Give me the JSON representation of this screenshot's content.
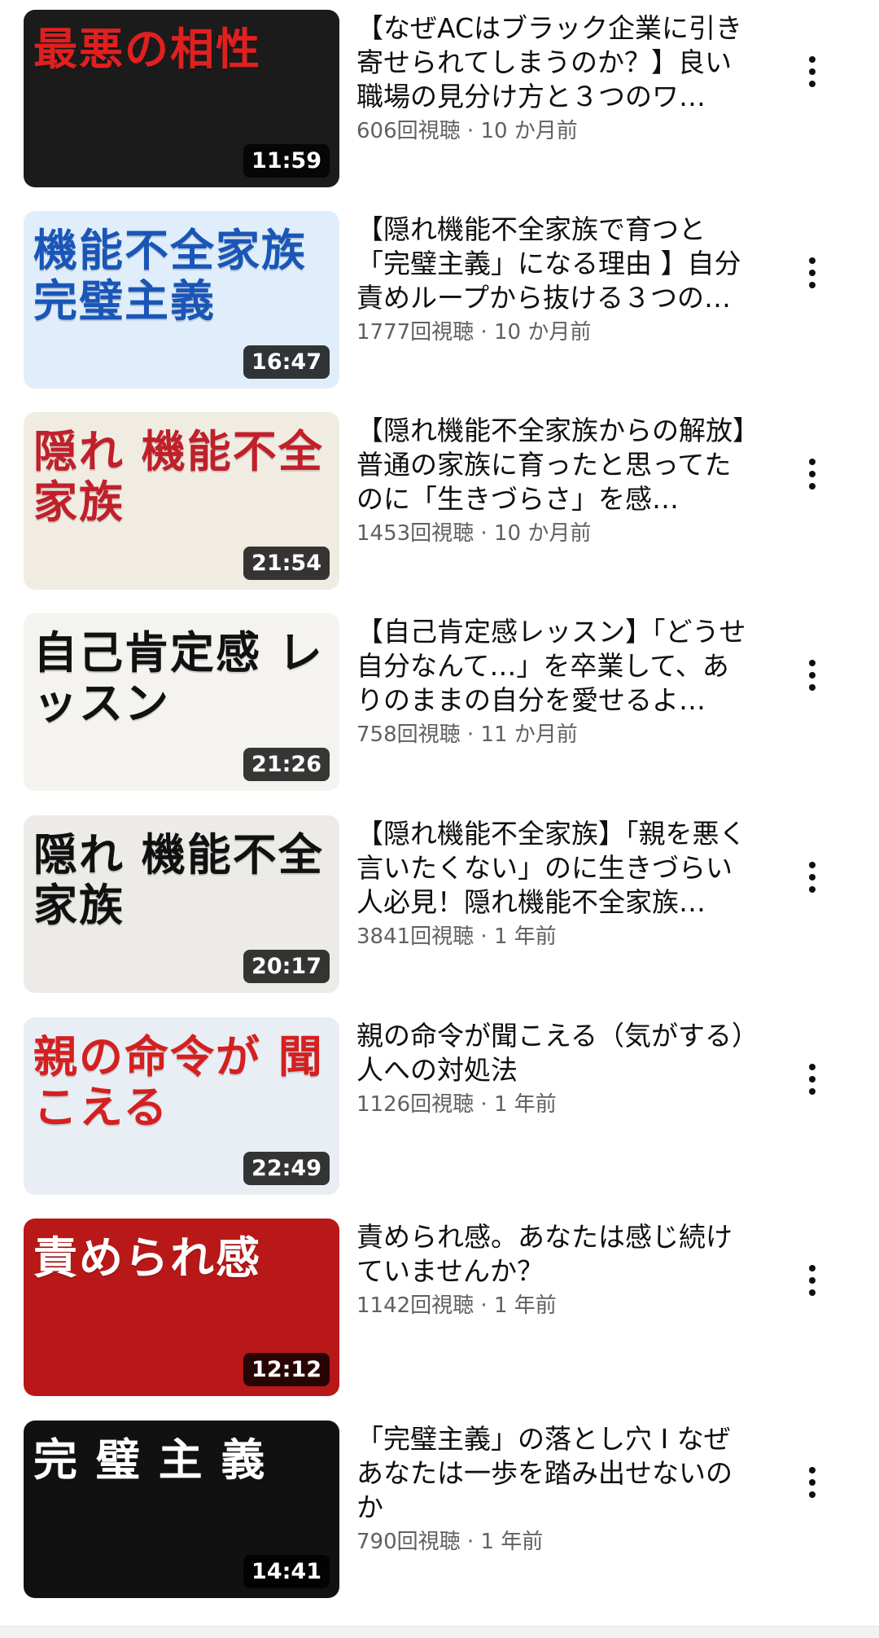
{
  "videos": [
    {
      "title": "【なぜACはブラック企業に引き寄せられてしまうのか？】良い職場の見分け方と３つのワ…",
      "views": "606回視聴",
      "age": "10 か月前",
      "duration": "11:59",
      "thumb_text": "最悪の相性",
      "thumb_bg": "#1b1b1b",
      "thumb_fg": "#e02020"
    },
    {
      "title": "【隠れ機能不全家族で育つと「完璧主義」になる理由 】自分責めループから抜ける３つの…",
      "views": "1777回視聴",
      "age": "10 か月前",
      "duration": "16:47",
      "thumb_text": "機能不全家族 完璧主義",
      "thumb_bg": "#dfeefa",
      "thumb_fg": "#1a56b8"
    },
    {
      "title": "【隠れ機能不全家族からの解放】普通の家族に育ったと思ってたのに「生きづらさ」を感…",
      "views": "1453回視聴",
      "age": "10 か月前",
      "duration": "21:54",
      "thumb_text": "隠れ 機能不全家族",
      "thumb_bg": "#f1ece2",
      "thumb_fg": "#c0202a"
    },
    {
      "title": "【自己肯定感レッスン】「どうせ自分なんて…」を卒業して、ありのままの自分を愛せるよ…",
      "views": "758回視聴",
      "age": "11 か月前",
      "duration": "21:26",
      "thumb_text": "自己肯定感 レッスン",
      "thumb_bg": "#f4f3ef",
      "thumb_fg": "#111111"
    },
    {
      "title": "【隠れ機能不全家族】「親を悪く言いたくない」のに生きづらい人必見！隠れ機能不全家族…",
      "views": "3841回視聴",
      "age": "1 年前",
      "duration": "20:17",
      "thumb_text": "隠れ 機能不全 家族",
      "thumb_bg": "#ecebe8",
      "thumb_fg": "#111111"
    },
    {
      "title": "親の命令が聞こえる（気がする）人への対処法",
      "views": "1126回視聴",
      "age": "1 年前",
      "duration": "22:49",
      "thumb_text": "親の命令が 聞こえる",
      "thumb_bg": "#e9eef4",
      "thumb_fg": "#d42020"
    },
    {
      "title": "責められ感。あなたは感じ続けていませんか？",
      "views": "1142回視聴",
      "age": "1 年前",
      "duration": "12:12",
      "thumb_text": "責められ感",
      "thumb_bg": "#b81818",
      "thumb_fg": "#ffffff"
    },
    {
      "title": "「完璧主義」の落とし穴 I なぜあなたは一歩を踏み出せないのか",
      "views": "790回視聴",
      "age": "1 年前",
      "duration": "14:41",
      "thumb_text": "完 璧 主 義",
      "thumb_bg": "#111111",
      "thumb_fg": "#ffffff"
    }
  ]
}
